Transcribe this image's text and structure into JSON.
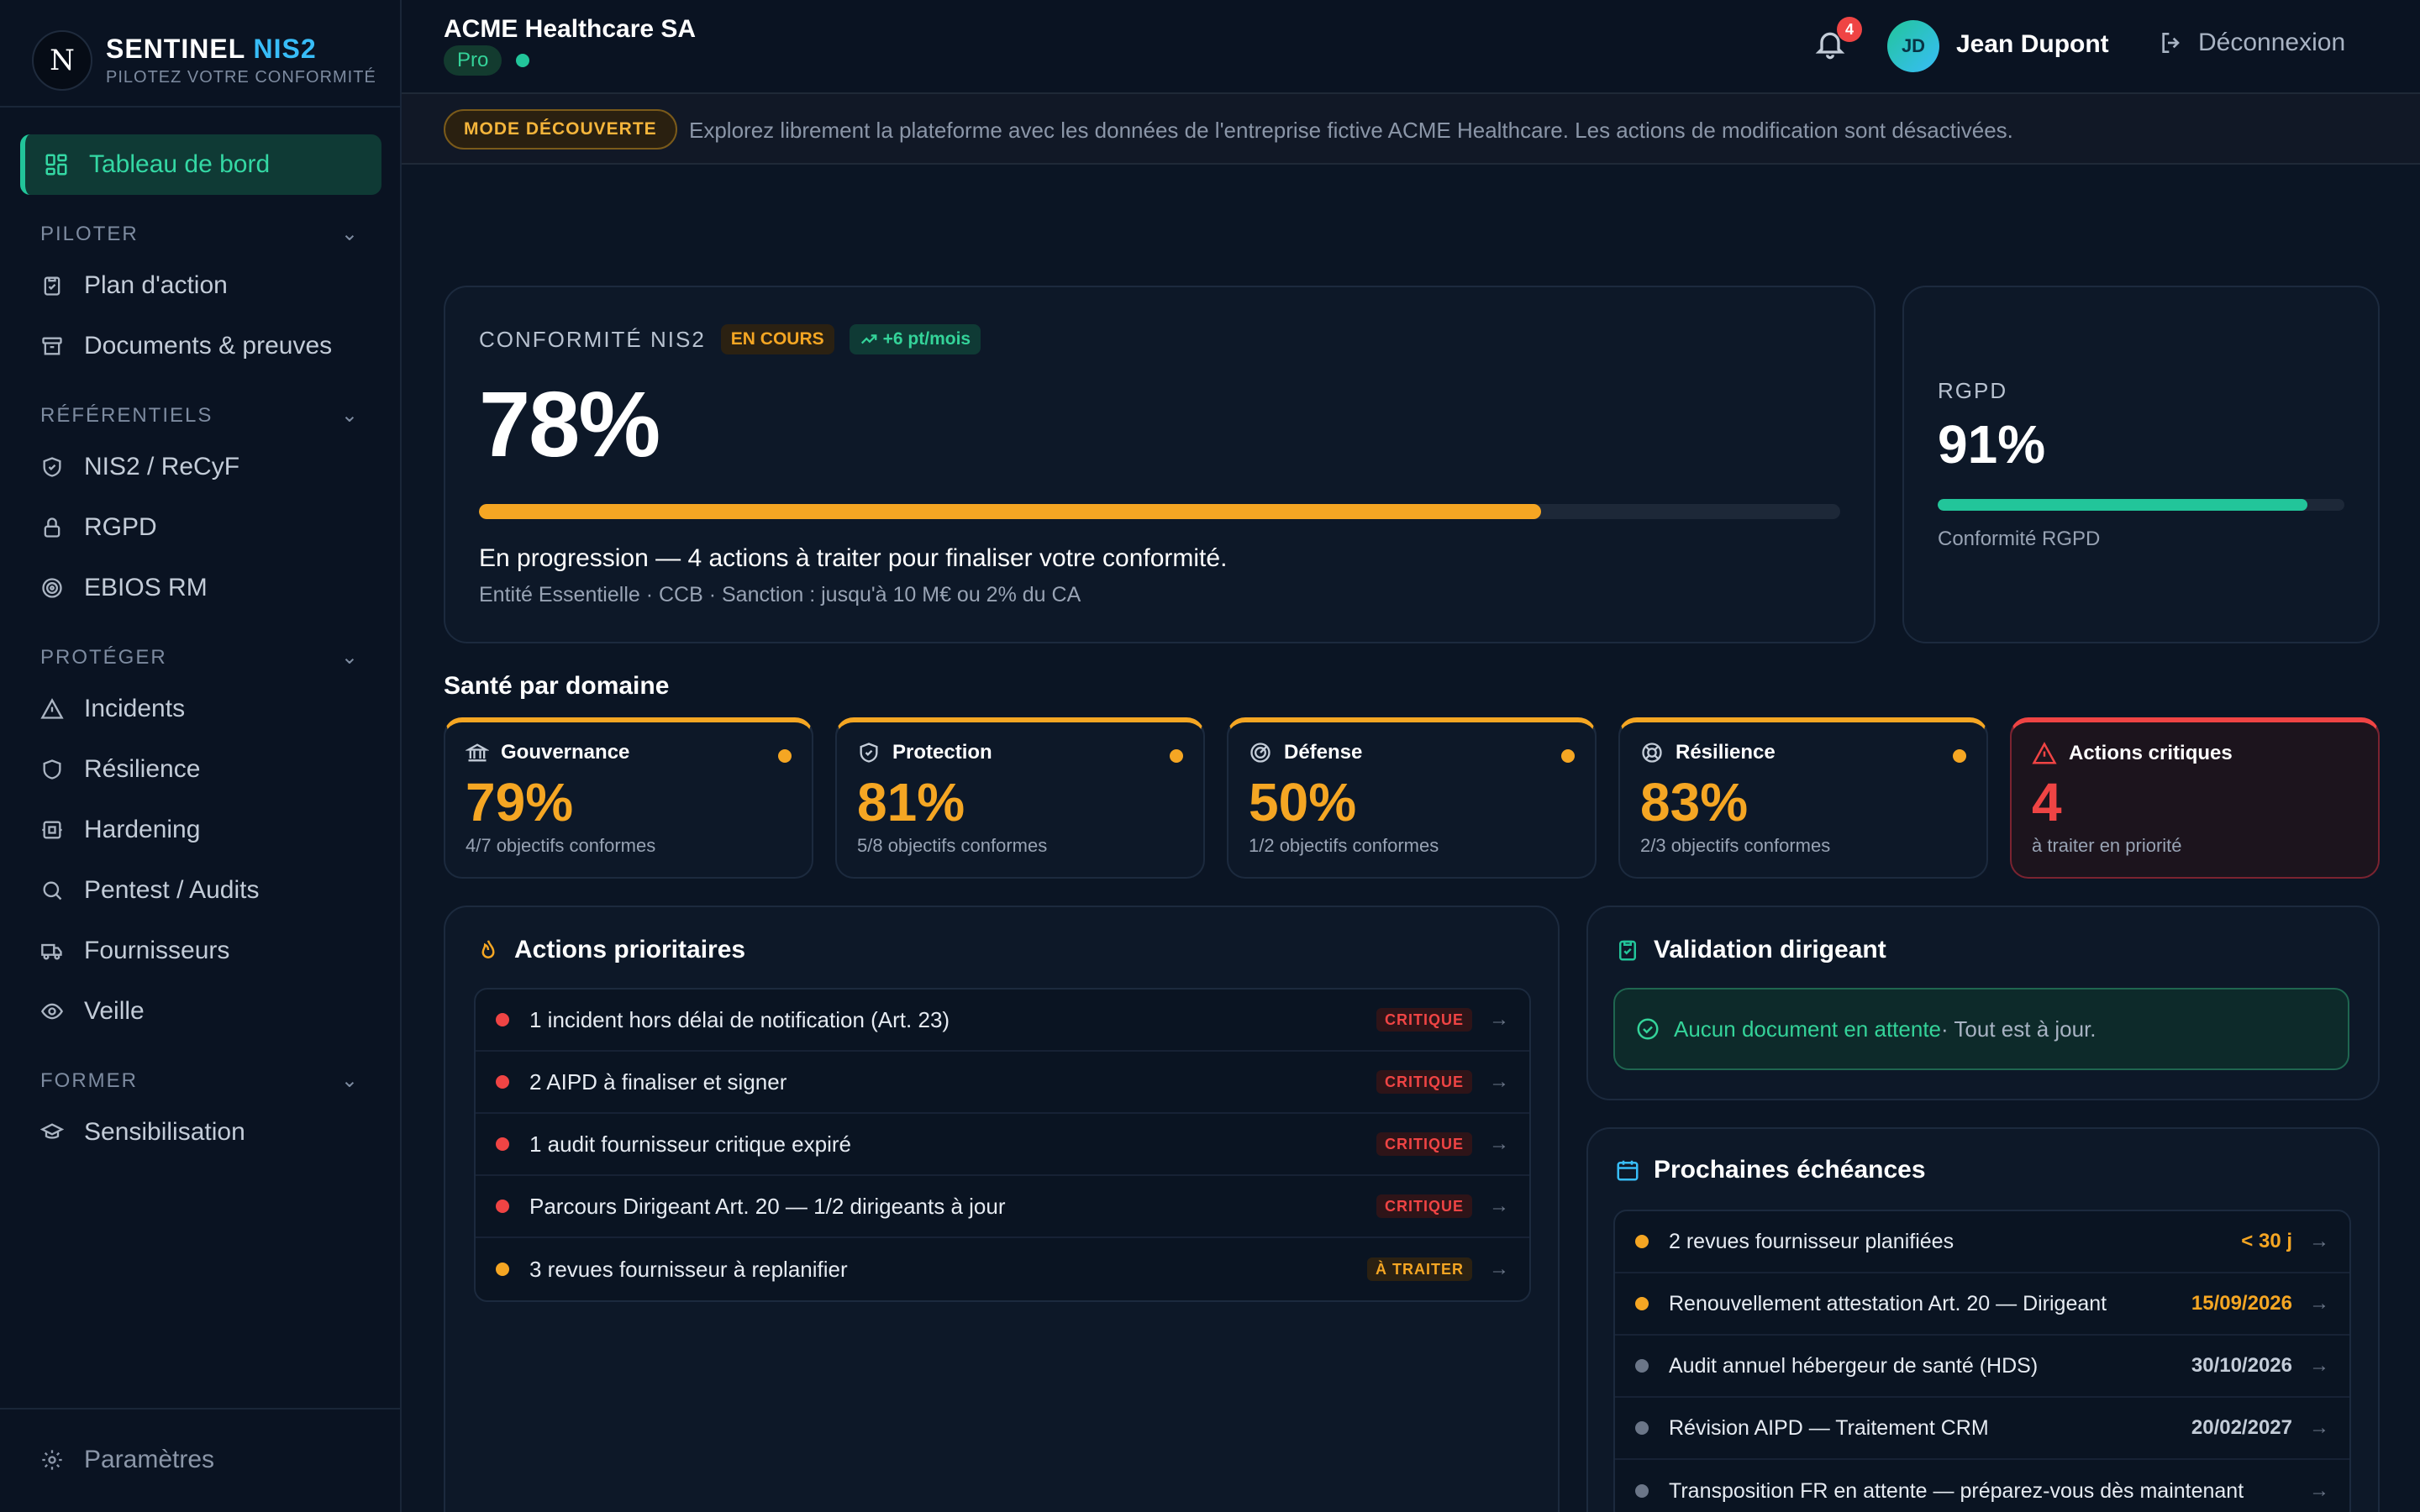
{
  "brand": {
    "name": "SENTINEL",
    "name_accent": "NIS2",
    "tagline": "PILOTEZ VOTRE CONFORMITÉ",
    "logo_letter": "N"
  },
  "sidebar": {
    "active": "Tableau de bord",
    "sections": [
      {
        "title": "PILOTER",
        "items": [
          "Plan d'action",
          "Documents & preuves"
        ]
      },
      {
        "title": "RÉFÉRENTIELS",
        "items": [
          "NIS2 / ReCyF",
          "RGPD",
          "EBIOS RM"
        ]
      },
      {
        "title": "PROTÉGER",
        "items": [
          "Incidents",
          "Résilience",
          "Hardening",
          "Pentest / Audits",
          "Fournisseurs",
          "Veille"
        ]
      },
      {
        "title": "FORMER",
        "items": [
          "Sensibilisation"
        ]
      }
    ],
    "settings": "Paramètres"
  },
  "header": {
    "company": "ACME Healthcare SA",
    "plan": "Pro",
    "notifications": "4",
    "user_initials": "JD",
    "user_name": "Jean Dupont",
    "logout": "Déconnexion"
  },
  "banner": {
    "mode": "MODE DÉCOUVERTE",
    "text": "Explorez librement la plateforme avec les données de l'entreprise fictive ACME Healthcare. Les actions de modification sont désactivées."
  },
  "nis2": {
    "label": "CONFORMITÉ NIS2",
    "status": "EN COURS",
    "trend": "+6 pt/mois",
    "value": "78%",
    "progress": 0.78,
    "message": "En progression — 4 actions à traiter pour finaliser votre conformité.",
    "details": "Entité Essentielle · CCB · Sanction : jusqu'à 10 M€ ou 2% du CA"
  },
  "rgpd": {
    "label": "RGPD",
    "value": "91%",
    "progress": 0.91,
    "sub": "Conformité RGPD"
  },
  "health": {
    "title": "Santé par domaine",
    "domains": [
      {
        "name": "Gouvernance",
        "value": "79%",
        "sub": "4/7 objectifs conformes"
      },
      {
        "name": "Protection",
        "value": "81%",
        "sub": "5/8 objectifs conformes"
      },
      {
        "name": "Défense",
        "value": "50%",
        "sub": "1/2 objectifs conformes"
      },
      {
        "name": "Résilience",
        "value": "83%",
        "sub": "2/3 objectifs conformes"
      }
    ],
    "critical": {
      "name": "Actions critiques",
      "value": "4",
      "sub": "à traiter en priorité"
    }
  },
  "actions": {
    "title": "Actions prioritaires",
    "items": [
      {
        "text": "1 incident hors délai de notification (Art. 23)",
        "tag": "CRITIQUE",
        "level": "crit"
      },
      {
        "text": "2 AIPD à finaliser et signer",
        "tag": "CRITIQUE",
        "level": "crit"
      },
      {
        "text": "1 audit fournisseur critique expiré",
        "tag": "CRITIQUE",
        "level": "crit"
      },
      {
        "text": "Parcours Dirigeant Art. 20 — 1/2 dirigeants à jour",
        "tag": "CRITIQUE",
        "level": "crit"
      },
      {
        "text": "3 revues fournisseur à replanifier",
        "tag": "À TRAITER",
        "level": "todo"
      }
    ]
  },
  "validation": {
    "title": "Validation dirigeant",
    "ok": "Aucun document en attente",
    "rest": " · Tout est à jour."
  },
  "deadlines": {
    "title": "Prochaines échéances",
    "items": [
      {
        "text": "2 revues fournisseur planifiées",
        "date": "< 30 j",
        "tone": "warn"
      },
      {
        "text": "Renouvellement attestation Art. 20 — Dirigeant",
        "date": "15/09/2026",
        "tone": "warn"
      },
      {
        "text": "Audit annuel hébergeur de santé (HDS)",
        "date": "30/10/2026",
        "tone": "neutral"
      },
      {
        "text": "Révision AIPD — Traitement CRM",
        "date": "20/02/2027",
        "tone": "neutral"
      },
      {
        "text": "Transposition FR en attente — préparez-vous dès maintenant",
        "date": "",
        "tone": "neutral"
      }
    ]
  },
  "colors": {
    "accent": "#22c59a",
    "warn": "#f5a623",
    "critical": "#ef4444",
    "neutral": "#6b7688"
  }
}
